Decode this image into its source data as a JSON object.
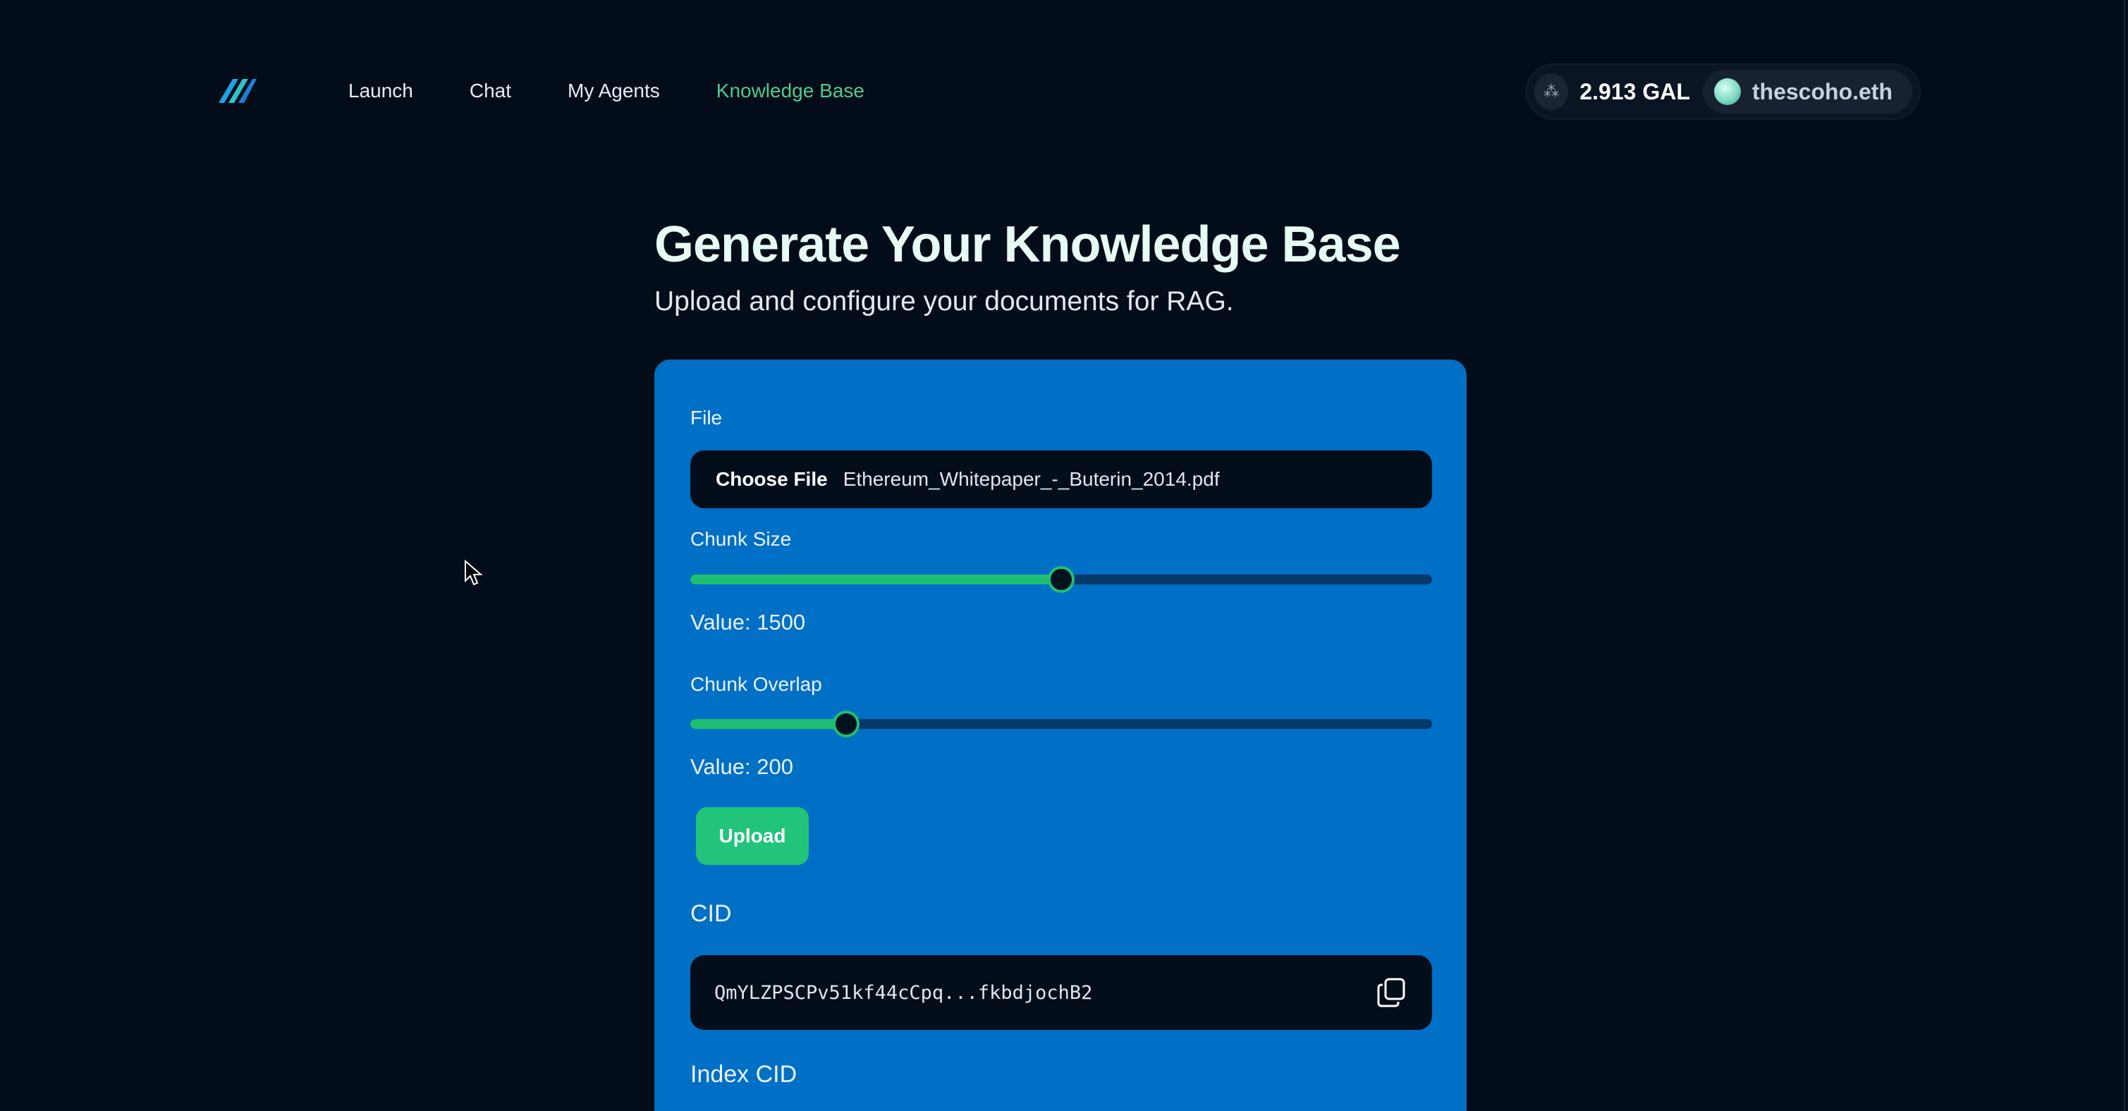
{
  "nav": {
    "links": [
      {
        "label": "Launch",
        "active": false
      },
      {
        "label": "Chat",
        "active": false
      },
      {
        "label": "My Agents",
        "active": false
      },
      {
        "label": "Knowledge Base",
        "active": true
      }
    ],
    "active_color": "#52c98f"
  },
  "wallet": {
    "icon": "network-icon",
    "balance": "2.913 GAL",
    "account": "thescoho.eth"
  },
  "header": {
    "title": "Generate Your Knowledge Base",
    "subtitle": "Upload and configure your documents for RAG."
  },
  "form": {
    "file": {
      "label": "File",
      "button_label": "Choose File",
      "file_name": "Ethereum_Whitepaper_-_Buterin_2014.pdf"
    },
    "chunk_size": {
      "label": "Chunk Size",
      "value_text": "Value: 1500",
      "fraction": 0.5
    },
    "chunk_overlap": {
      "label": "Chunk Overlap",
      "value_text": "Value: 200",
      "fraction": 0.21
    },
    "upload_label": "Upload",
    "cid": {
      "label": "CID",
      "value": "QmYLZPSCPv51kf44cCpq...fkbdjochB2",
      "copy_icon": "copy-icon"
    },
    "index_cid": {
      "label": "Index CID"
    }
  },
  "colors": {
    "background": "#030c19",
    "card": "#006fc6",
    "accent": "#21c47a"
  }
}
